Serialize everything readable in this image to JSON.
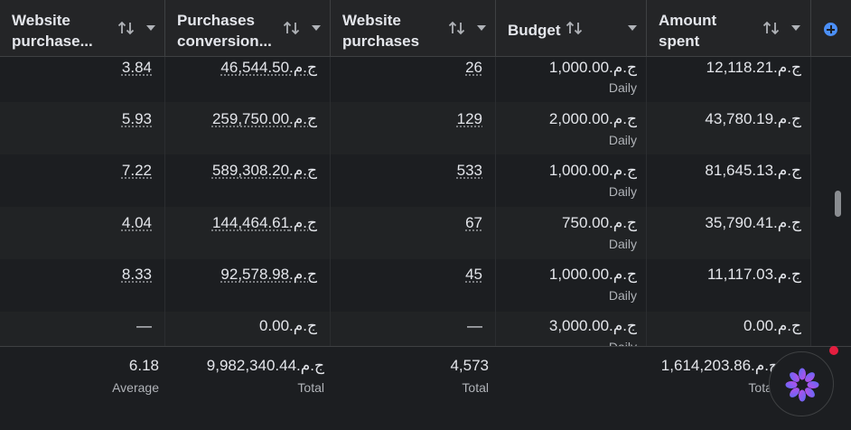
{
  "columns": [
    {
      "title_line1": "Website",
      "title_line2": "purchase..."
    },
    {
      "title_line1": "Purchases",
      "title_line2": "conversion..."
    },
    {
      "title_line1": "Website",
      "title_line2": "purchases"
    },
    {
      "title_line1": "Budget",
      "title_line2": ""
    },
    {
      "title_line1": "Amount",
      "title_line2": "spent"
    }
  ],
  "rows": [
    {
      "roas": "3.84",
      "conv_value": "ج.م.46,544.50",
      "purchases": "26",
      "budget": "ج.م.1,000.00",
      "budget_type": "Daily",
      "spent": "ج.م.12,118.21"
    },
    {
      "roas": "5.93",
      "conv_value": "ج.م.259,750.00",
      "purchases": "129",
      "budget": "ج.م.2,000.00",
      "budget_type": "Daily",
      "spent": "ج.م.43,780.19"
    },
    {
      "roas": "7.22",
      "conv_value": "ج.م.589,308.20",
      "purchases": "533",
      "budget": "ج.م.1,000.00",
      "budget_type": "Daily",
      "spent": "ج.م.81,645.13"
    },
    {
      "roas": "4.04",
      "conv_value": "ج.م.144,464.61",
      "purchases": "67",
      "budget": "ج.م.750.00",
      "budget_type": "Daily",
      "spent": "ج.م.35,790.41"
    },
    {
      "roas": "8.33",
      "conv_value": "ج.م.92,578.98",
      "purchases": "45",
      "budget": "ج.م.1,000.00",
      "budget_type": "Daily",
      "spent": "ج.م.11,117.03"
    },
    {
      "roas": "—",
      "conv_value": "ج.م.0.00",
      "purchases": "—",
      "budget": "ج.م.3,000.00",
      "budget_type": "Daily",
      "spent": "ج.م.0.00"
    }
  ],
  "footer": {
    "roas": "6.18",
    "roas_label": "Average",
    "conv_value": "ج.م.9,982,340.44",
    "conv_value_label": "Total",
    "purchases": "4,573",
    "purchases_label": "Total",
    "spent": "ج.م.1,614,203.86",
    "spent_label": "Total"
  },
  "icons": {
    "sort": "sort-arrows-icon",
    "dropdown": "chevron-down-icon",
    "add_column": "plus-circle-icon",
    "assistant": "ai-assistant-icon"
  },
  "colors": {
    "accent": "#4b8ff7",
    "notification": "#e41e3f",
    "assistant_gradient": [
      "#5b6cf7",
      "#c04be8"
    ]
  }
}
